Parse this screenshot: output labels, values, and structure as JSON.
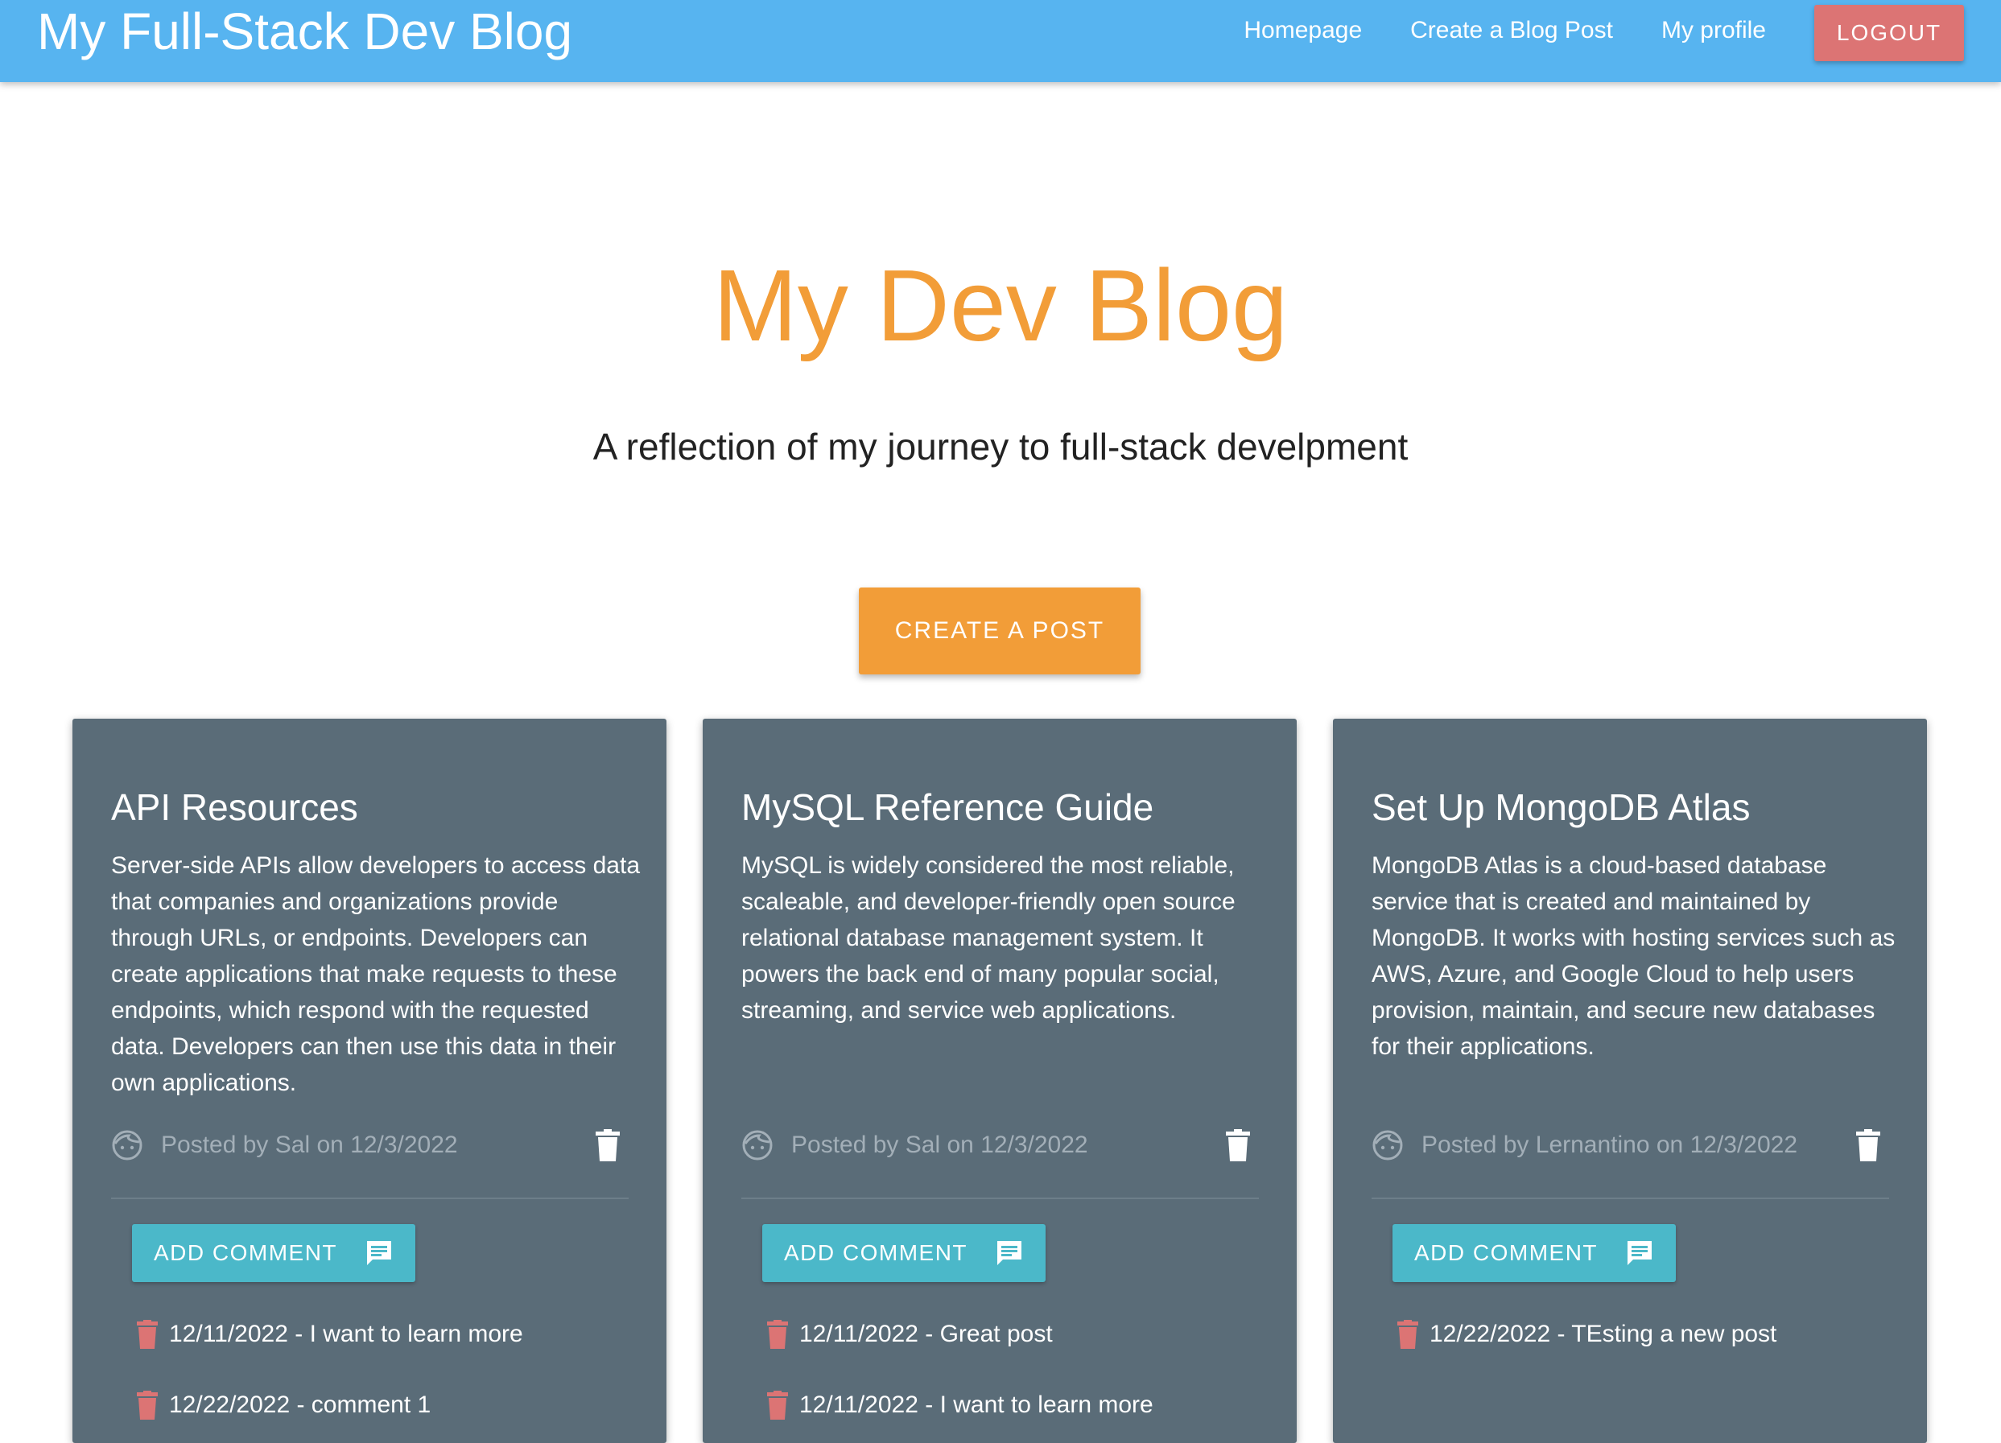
{
  "navbar": {
    "brand": "My Full-Stack Dev Blog",
    "links": [
      "Homepage",
      "Create a Blog Post",
      "My profile"
    ],
    "logout_label": "LOGOUT",
    "color": "#57b4f0"
  },
  "hero": {
    "title": "My Dev Blog",
    "subtitle": "A reflection of my journey to full-stack develpment",
    "create_post_label": "CREATE A POST",
    "accent_color": "#f29d38"
  },
  "posts": [
    {
      "title": "API Resources",
      "body": "Server-side APIs allow developers to access data that companies and organizations provide through URLs, or endpoints. Developers can create applications that make requests to these endpoints, which respond with the requested data. Developers can then use this data in their own applications.",
      "meta": "Posted by Sal on 12/3/2022",
      "add_comment_label": "ADD COMMENT",
      "comments": [
        "12/11/2022 - I want to learn more",
        "12/22/2022 - comment 1"
      ]
    },
    {
      "title": "MySQL Reference Guide",
      "body": "MySQL is widely considered the most reliable, scaleable, and developer-friendly open source relational database management system. It powers the back end of many popular social, streaming, and service web applications.",
      "meta": "Posted by Sal on 12/3/2022",
      "add_comment_label": "ADD COMMENT",
      "comments": [
        "12/11/2022 - Great post",
        "12/11/2022 - I want to learn more"
      ]
    },
    {
      "title": "Set Up MongoDB Atlas",
      "body": "MongoDB Atlas is a cloud-based database service that is created and maintained by MongoDB. It works with hosting services such as AWS, Azure, and Google Cloud to help users provision, maintain, and secure new databases for their applications.",
      "meta": "Posted by Lernantino on 12/3/2022",
      "add_comment_label": "ADD COMMENT",
      "comments": [
        "12/22/2022 - TEsting a new post"
      ]
    }
  ],
  "icons": {
    "author": "face-icon",
    "delete_post": "trash-icon",
    "comment": "comment-icon",
    "delete_comment": "trash-icon"
  },
  "colors": {
    "card_bg": "#5a6c78",
    "comment_button": "#4bb8c9",
    "logout_button": "#dc7474",
    "delete_comment": "#dc7474"
  }
}
